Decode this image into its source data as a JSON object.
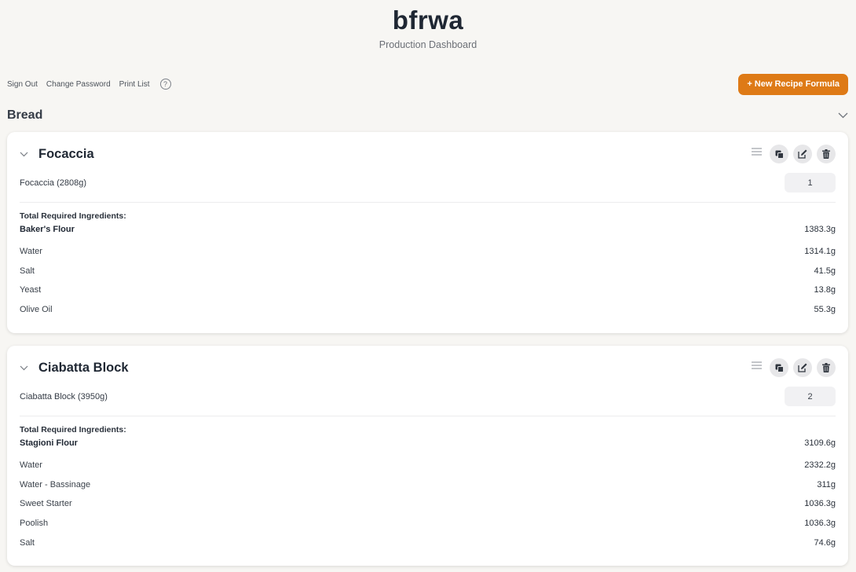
{
  "app": {
    "title": "bfrwa",
    "subtitle": "Production Dashboard"
  },
  "nav": {
    "sign_out": "Sign Out",
    "change_password": "Change Password",
    "print_list": "Print List",
    "help_glyph": "?"
  },
  "actions": {
    "new_recipe": "+ New Recipe Formula"
  },
  "section": {
    "title": "Bread"
  },
  "colors": {
    "accent": "#de7a16",
    "background": "#f7f6f3",
    "card": "#ffffff"
  },
  "icons": [
    "help-icon",
    "chevron-down-icon",
    "drag-handle-icon",
    "copy-icon",
    "edit-icon",
    "trash-icon"
  ],
  "recipes": [
    {
      "title": "Focaccia",
      "batch_label": "Focaccia (2808g)",
      "quantity": "1",
      "ingredients_heading": "Total Required Ingredients:",
      "ingredients": [
        {
          "name": "Baker's Flour",
          "amount": "1383.3g"
        },
        {
          "name": "Water",
          "amount": "1314.1g"
        },
        {
          "name": "Salt",
          "amount": "41.5g"
        },
        {
          "name": "Yeast",
          "amount": "13.8g"
        },
        {
          "name": "Olive Oil",
          "amount": "55.3g"
        }
      ]
    },
    {
      "title": "Ciabatta Block",
      "batch_label": "Ciabatta Block (3950g)",
      "quantity": "2",
      "ingredients_heading": "Total Required Ingredients:",
      "ingredients": [
        {
          "name": "Stagioni Flour",
          "amount": "3109.6g"
        },
        {
          "name": "Water",
          "amount": "2332.2g"
        },
        {
          "name": "Water - Bassinage",
          "amount": "311g"
        },
        {
          "name": "Sweet Starter",
          "amount": "1036.3g"
        },
        {
          "name": "Poolish",
          "amount": "1036.3g"
        },
        {
          "name": "Salt",
          "amount": "74.6g"
        }
      ]
    }
  ]
}
